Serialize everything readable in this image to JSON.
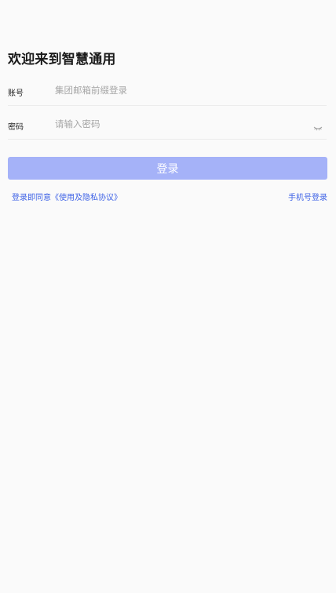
{
  "header": {
    "title": "欢迎来到智慧通用"
  },
  "form": {
    "account": {
      "label": "账号",
      "placeholder": "集团邮箱前缀登录",
      "value": ""
    },
    "password": {
      "label": "密码",
      "placeholder": "请输入密码",
      "value": "",
      "visibility_icon": "eye-closed-icon"
    },
    "login_button_label": "登录"
  },
  "footer": {
    "agreement_text": "登录即同意《使用及隐私协议》",
    "phone_login_text": "手机号登录"
  },
  "colors": {
    "background": "#fafafa",
    "button": "#a5b2f8",
    "link": "#3f63e6"
  }
}
